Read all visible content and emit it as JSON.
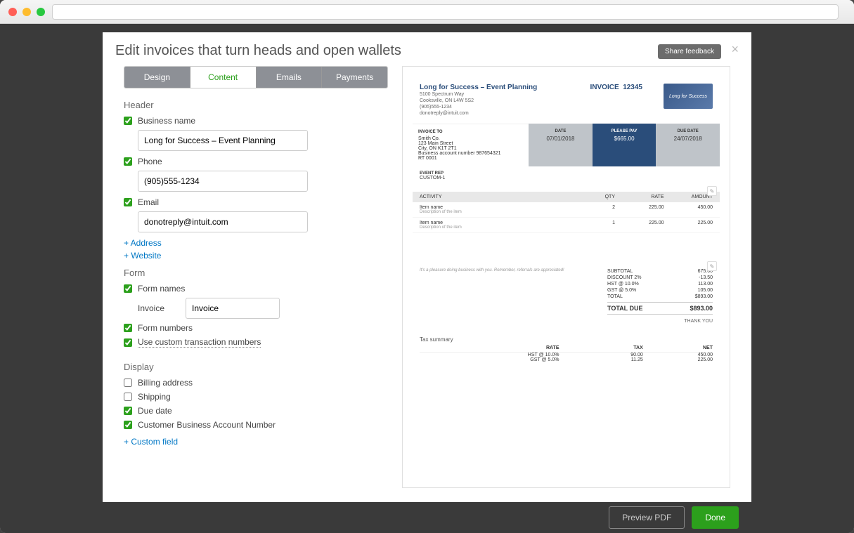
{
  "modal": {
    "title": "Edit invoices that turn heads and open wallets",
    "feedback": "Share feedback"
  },
  "tabs": {
    "design": "Design",
    "content": "Content",
    "emails": "Emails",
    "payments": "Payments"
  },
  "sections": {
    "header": "Header",
    "form": "Form",
    "display": "Display"
  },
  "fields": {
    "bizname_lbl": "Business name",
    "bizname_val": "Long for Success – Event Planning",
    "phone_lbl": "Phone",
    "phone_val": "(905)555-1234",
    "email_lbl": "Email",
    "email_val": "donotreply@intuit.com",
    "add_address": "+ Address",
    "add_website": "+ Website",
    "form_names_lbl": "Form names",
    "invoice_lbl": "Invoice",
    "invoice_val": "Invoice",
    "form_numbers_lbl": "Form numbers",
    "custom_tx_lbl": "Use custom transaction numbers",
    "billing_lbl": "Billing address",
    "shipping_lbl": "Shipping",
    "duedate_lbl": "Due date",
    "ban_lbl": "Customer Business Account Number",
    "custom_field": "+ Custom field"
  },
  "preview": {
    "company": "Long for Success – Event Planning",
    "addr1": "5100 Spectrum Way",
    "addr2": "Cooksville, ON L4W 5S2",
    "addr3": "(905)555-1234",
    "addr4": "donotreply@intuit.com",
    "inv_lbl": "INVOICE",
    "inv_no": "12345",
    "logo_text": "Long for Success",
    "bill_to_lbl": "INVOICE TO",
    "bill1": "Smith Co.",
    "bill2": "123 Main Street",
    "bill3": "City, ON K1T 2T1",
    "bill4": "Business account number 987654321",
    "bill5": "RT 0001",
    "date_lbl": "DATE",
    "date_val": "07/01/2018",
    "pay_lbl": "PLEASE PAY",
    "pay_val": "$665.00",
    "due_lbl": "DUE DATE",
    "due_val": "24/07/2018",
    "event_lbl": "EVENT REP",
    "event_val": "CUSTOM-1",
    "th_act": "ACTIVITY",
    "th_qty": "QTY",
    "th_rate": "RATE",
    "th_amt": "AMOUNT",
    "r1_name": "Item name",
    "r1_desc": "Description of the item",
    "r1_qty": "2",
    "r1_rate": "225.00",
    "r1_amt": "450.00",
    "r2_name": "Item name",
    "r2_desc": "Description of the item",
    "r2_qty": "1",
    "r2_rate": "225.00",
    "r2_amt": "225.00",
    "note": "It's a pleasure doing business with you. Remember, referrals are appreciated!",
    "sub_lbl": "SUBTOTAL",
    "sub_val": "675.00",
    "disc_lbl": "DISCOUNT 2%",
    "disc_val": "-13.50",
    "hst_lbl": "HST @ 10.0%",
    "hst_val": "113.00",
    "gst_lbl": "GST @ 5.0%",
    "gst_val": "105.00",
    "tot_lbl": "TOTAL",
    "tot_val": "$893.00",
    "totdue_lbl": "TOTAL DUE",
    "totdue_val": "$893.00",
    "thanks": "THANK YOU",
    "tax_title": "Tax summary",
    "tx_rate": "RATE",
    "tx_tax": "TAX",
    "tx_net": "NET",
    "tx1_r": "HST @ 10.0%",
    "tx1_t": "90.00",
    "tx1_n": "450.00",
    "tx2_r": "GST @ 5.0%",
    "tx2_t": "11.25",
    "tx2_n": "225.00"
  },
  "footer": {
    "preview": "Preview PDF",
    "done": "Done"
  }
}
